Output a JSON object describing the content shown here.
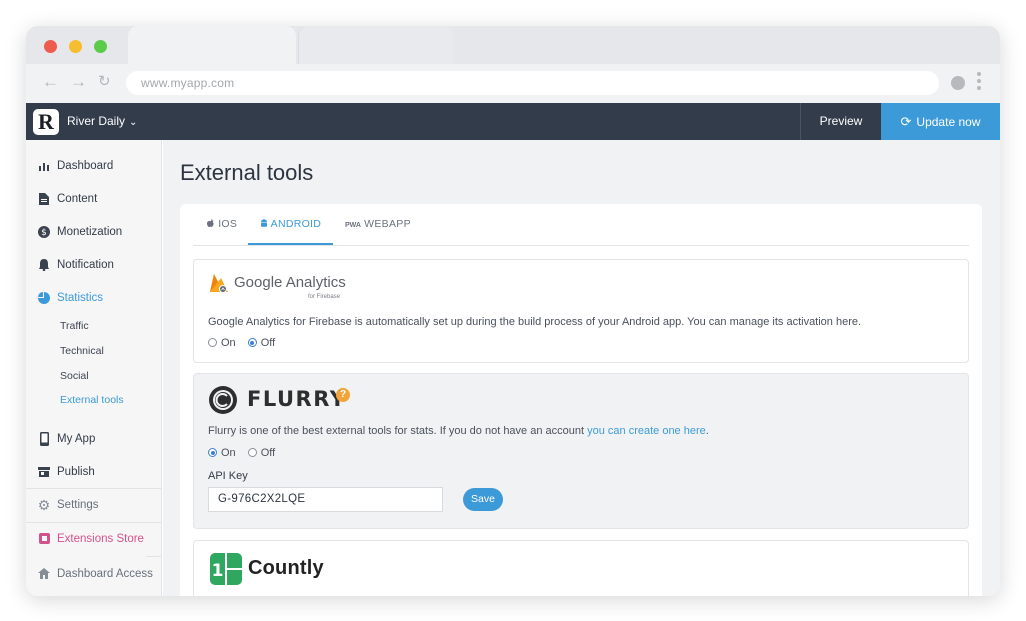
{
  "browser": {
    "url": "www.myapp.com"
  },
  "header": {
    "app_name": "River Daily",
    "logo_letter": "R",
    "preview_label": "Preview",
    "update_label": "Update now"
  },
  "sidebar": {
    "items": [
      {
        "label": "Dashboard",
        "icon": "bar-chart-icon"
      },
      {
        "label": "Content",
        "icon": "document-icon"
      },
      {
        "label": "Monetization",
        "icon": "dollar-icon"
      },
      {
        "label": "Notification",
        "icon": "bell-icon"
      },
      {
        "label": "Statistics",
        "icon": "pie-chart-icon",
        "active": true
      }
    ],
    "sub_items": [
      {
        "label": "Traffic"
      },
      {
        "label": "Technical"
      },
      {
        "label": "Social"
      },
      {
        "label": "External tools",
        "active": true
      }
    ],
    "items2": [
      {
        "label": "My App",
        "icon": "phone-icon"
      },
      {
        "label": "Publish",
        "icon": "store-icon"
      }
    ],
    "footer_items": [
      {
        "label": "Settings",
        "icon": "gear-icon"
      },
      {
        "label": "Extensions Store",
        "icon": "puzzle-icon"
      },
      {
        "label": "Dashboard Access",
        "icon": "home-icon"
      }
    ]
  },
  "main": {
    "title": "External tools",
    "tabs": [
      {
        "label": "IOS",
        "icon": "apple-icon"
      },
      {
        "label": "ANDROID",
        "icon": "android-icon",
        "active": true
      },
      {
        "label": "WEBAPP",
        "icon": "pwa-icon",
        "prefix": "PWA"
      }
    ],
    "google_analytics": {
      "name": "Google Analytics",
      "sub": "for Firebase",
      "description": "Google Analytics for Firebase is automatically set up during the build process of your Android app. You can manage its activation here.",
      "on_label": "On",
      "off_label": "Off",
      "selected": "Off"
    },
    "flurry": {
      "name": "FLURRY",
      "help": "?",
      "description": "Flurry is one of the best external tools for stats. If you do not have an account ",
      "link_text": "you can create one here",
      "description_end": ".",
      "on_label": "On",
      "off_label": "Off",
      "selected": "On",
      "api_key_label": "API Key",
      "api_key_value": "G-976C2X2LQE",
      "save_label": "Save"
    },
    "countly": {
      "name": "Countly"
    }
  },
  "colors": {
    "accent": "#3d9ad8",
    "header_bg": "#323c4b",
    "pink": "#d4528c",
    "help_orange": "#f0a43a"
  }
}
